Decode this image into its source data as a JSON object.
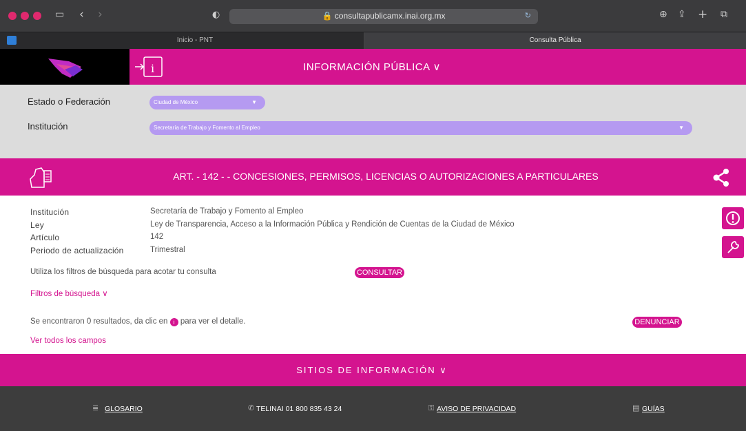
{
  "browser": {
    "url": "consultapublicamx.inai.org.mx",
    "tabs": [
      {
        "label": "Inicio - PNT"
      },
      {
        "label": "Consulta Pública"
      }
    ]
  },
  "header": {
    "title": "INFORMACIÓN PÚBLICA ∨"
  },
  "filters": {
    "estado_label": "Estado o Federación",
    "estado_value": "Ciudad de México",
    "institucion_label": "Institución",
    "institucion_value": "Secretaría de Trabajo y Fomento al Empleo"
  },
  "article": {
    "title": "ART. - 142 - - CONCESIONES, PERMISOS, LICENCIAS O AUTORIZACIONES A PARTICULARES"
  },
  "info": {
    "rows": [
      {
        "label": "Institución",
        "value": "Secretaría de Trabajo y Fomento al Empleo"
      },
      {
        "label": "Ley",
        "value": "Ley de Transparencia, Acceso a la Información Pública y Rendición de Cuentas de la Ciudad de México"
      },
      {
        "label": "Artículo",
        "value": "142"
      },
      {
        "label": "Periodo de actualización",
        "value": "Trimestral"
      }
    ],
    "hint": "Utiliza los filtros de búsqueda para acotar tu consulta",
    "consultar": "CONSULTAR",
    "filtros_link": "Filtros de búsqueda ∨",
    "results_pre": "Se encontraron 0 resultados, da clic en",
    "results_post": "para ver el detalle.",
    "denunciar": "DENUNCIAR",
    "ver_todos": "Ver todos los campos"
  },
  "footer": {
    "sitios": "SITIOS DE INFORMACIÓN ∨",
    "links": [
      {
        "label": "GLOSARIO"
      },
      {
        "label": "TELINAI 01 800 835 43 24"
      },
      {
        "label": "AVISO DE PRIVACIDAD"
      },
      {
        "label": "GUÍAS"
      }
    ]
  },
  "colors": {
    "magenta": "#d4148f",
    "lavender": "#b59af1"
  }
}
